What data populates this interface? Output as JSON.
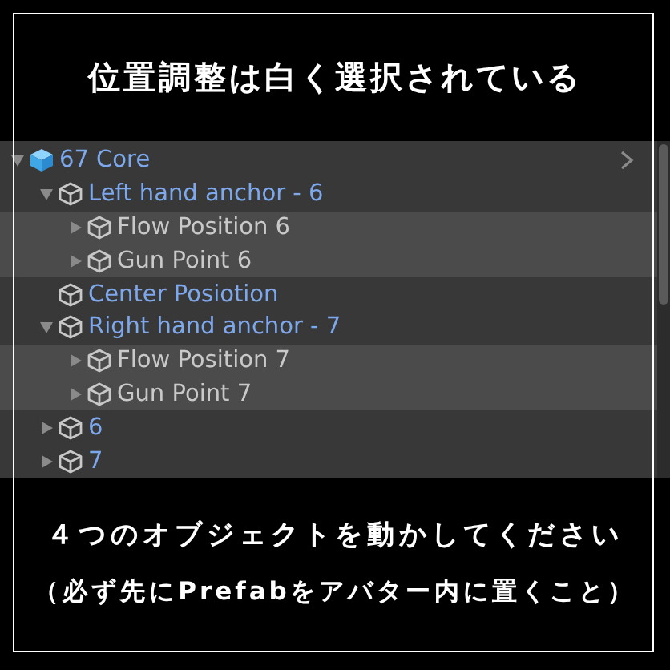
{
  "caption_top": "位置調整は白く選択されている",
  "hierarchy": {
    "items": [
      {
        "label": "67 Core",
        "kind": "prefab-root",
        "expanded": true,
        "selected": false,
        "children": [
          {
            "label": "Left hand anchor - 6",
            "kind": "prefab",
            "expanded": true,
            "selected": false,
            "children": [
              {
                "label": "Flow Position 6",
                "kind": "object",
                "expanded": false,
                "selected": true
              },
              {
                "label": "Gun Point 6",
                "kind": "object",
                "expanded": false,
                "selected": true
              }
            ]
          },
          {
            "label": "Center Posiotion",
            "kind": "prefab",
            "selected": false
          },
          {
            "label": "Right hand anchor - 7",
            "kind": "prefab",
            "expanded": true,
            "selected": false,
            "children": [
              {
                "label": "Flow Position 7",
                "kind": "object",
                "expanded": false,
                "selected": true
              },
              {
                "label": "Gun Point 7",
                "kind": "object",
                "expanded": false,
                "selected": true
              }
            ]
          },
          {
            "label": "6",
            "kind": "prefab",
            "expanded": false,
            "selected": false
          },
          {
            "label": "7",
            "kind": "prefab",
            "expanded": false,
            "selected": false
          }
        ]
      }
    ]
  },
  "caption_bottom": [
    "４つのオブジェクトを動かしてください",
    "（必ず先にPrefabをアバター内に置くこと）"
  ]
}
